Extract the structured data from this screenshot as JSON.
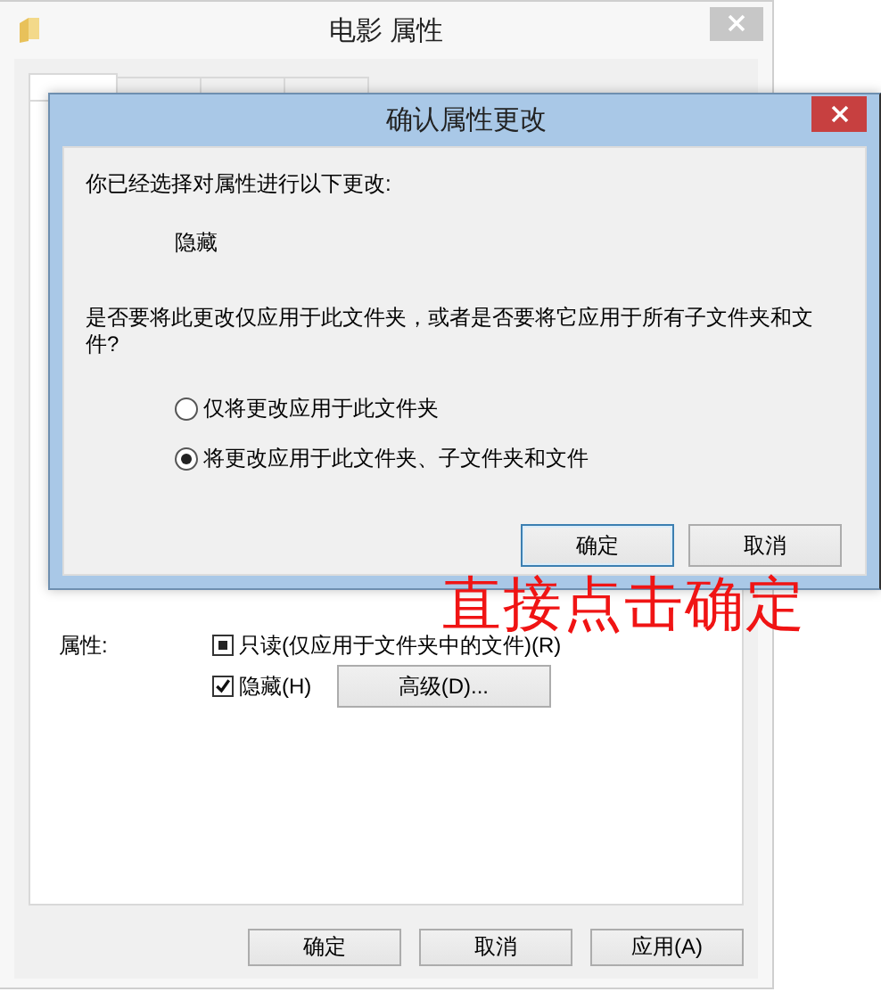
{
  "window": {
    "title": "电影 属性"
  },
  "tabs": [
    {
      "selected": true
    },
    {
      "selected": false
    },
    {
      "selected": false
    },
    {
      "selected": false
    }
  ],
  "attributes": {
    "label": "属性:",
    "checkboxes": [
      {
        "label": "只读(仅应用于文件夹中的文件)(R)",
        "checked": false,
        "indeterminate": true
      },
      {
        "label": "隐藏(H)",
        "checked": true
      }
    ],
    "advanced_button": "高级(D)..."
  },
  "buttons": [
    {
      "label": "确定"
    },
    {
      "label": "取消"
    },
    {
      "label": "应用(A)"
    }
  ],
  "dialog": {
    "title": "确认属性更改",
    "intro": "你已经选择对属性进行以下更改:",
    "change": "隐藏",
    "question": "是否要将此更改仅应用于此文件夹，或者是否要将它应用于所有子文件夹和文件?",
    "options": [
      {
        "label": "仅将更改应用于此文件夹",
        "selected": false
      },
      {
        "label": "将更改应用于此文件夹、子文件夹和文件",
        "selected": true
      }
    ],
    "buttons": [
      {
        "label": "确定",
        "focused": true
      },
      {
        "label": "取消",
        "focused": false
      }
    ]
  },
  "annotation": "直接点击确定"
}
